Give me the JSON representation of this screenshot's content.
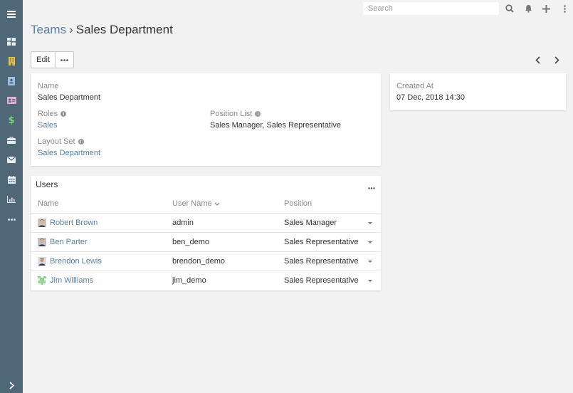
{
  "search": {
    "placeholder": "Search"
  },
  "breadcrumb": {
    "parent": "Teams",
    "separator": "›",
    "current": "Sales Department"
  },
  "toolbar": {
    "edit_label": "Edit"
  },
  "detail": {
    "name_label": "Name",
    "name_value": "Sales Department",
    "roles_label": "Roles",
    "roles_value": "Sales",
    "position_list_label": "Position List",
    "position_list_value": "Sales Manager, Sales Representative",
    "layout_set_label": "Layout Set",
    "layout_set_value": "Sales Department"
  },
  "side": {
    "created_at_label": "Created At",
    "created_at_value": "07 Dec, 2018 14:30"
  },
  "users": {
    "title": "Users",
    "columns": {
      "name": "Name",
      "user_name": "User Name",
      "position": "Position"
    },
    "rows": [
      {
        "name": "Robert Brown",
        "user_name": "admin",
        "position": "Sales Manager",
        "avatar": "person-photo"
      },
      {
        "name": "Ben Parter",
        "user_name": "ben_demo",
        "position": "Sales Representative",
        "avatar": "person-photo"
      },
      {
        "name": "Brendon Lewis",
        "user_name": "brendon_demo",
        "position": "Sales Representative",
        "avatar": "person-photo"
      },
      {
        "name": "Jim Williams",
        "user_name": "jim_demo",
        "position": "Sales Representative",
        "avatar": "default-avatar"
      }
    ]
  },
  "colors": {
    "sidebar": "#4e6878",
    "link": "#5a7ea5",
    "background": "#f2f2f2"
  },
  "icons": {
    "sidebar": [
      "menu-icon",
      "dashboard-icon",
      "building-icon",
      "contact-book-icon",
      "id-card-icon",
      "dollar-icon",
      "briefcase-icon",
      "envelope-icon",
      "calendar-icon",
      "chart-icon",
      "more-icon",
      "expand-icon"
    ],
    "topbar": [
      "search-icon",
      "bell-icon",
      "plus-icon",
      "vertical-dots-icon"
    ]
  }
}
